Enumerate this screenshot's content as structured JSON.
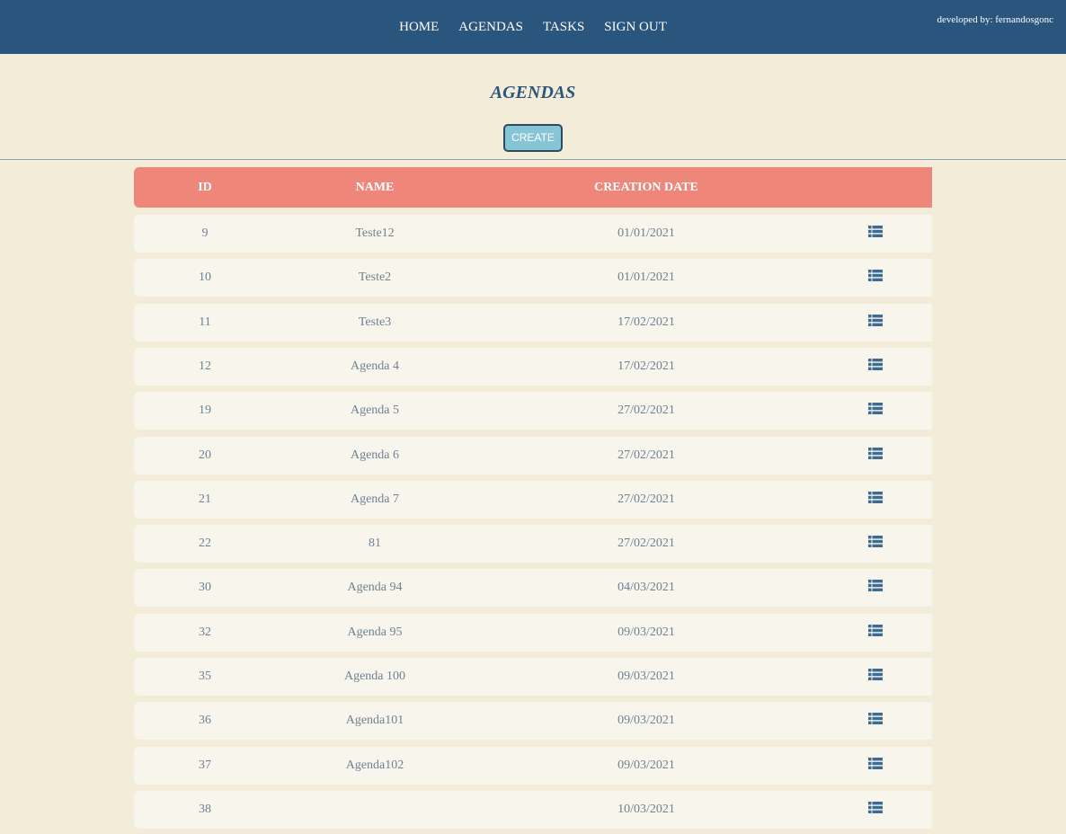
{
  "nav": {
    "items": [
      "HOME",
      "AGENDAS",
      "TASKS",
      "SIGN OUT"
    ],
    "credit": "developed by: fernandosgonc"
  },
  "page": {
    "title": "AGENDAS",
    "create_label": "CREATE"
  },
  "table": {
    "headers": [
      "ID",
      "NAME",
      "CREATION DATE",
      ""
    ],
    "rows": [
      {
        "id": "9",
        "name": "Teste12",
        "date": "01/01/2021"
      },
      {
        "id": "10",
        "name": "Teste2",
        "date": "01/01/2021"
      },
      {
        "id": "11",
        "name": "Teste3",
        "date": "17/02/2021"
      },
      {
        "id": "12",
        "name": "Agenda 4",
        "date": "17/02/2021"
      },
      {
        "id": "19",
        "name": "Agenda 5",
        "date": "27/02/2021"
      },
      {
        "id": "20",
        "name": "Agenda 6",
        "date": "27/02/2021"
      },
      {
        "id": "21",
        "name": "Agenda 7",
        "date": "27/02/2021"
      },
      {
        "id": "22",
        "name": "81",
        "date": "27/02/2021"
      },
      {
        "id": "30",
        "name": "Agenda 94",
        "date": "04/03/2021"
      },
      {
        "id": "32",
        "name": "Agenda 95",
        "date": "09/03/2021"
      },
      {
        "id": "35",
        "name": "Agenda 100",
        "date": "09/03/2021"
      },
      {
        "id": "36",
        "name": "Agenda101",
        "date": "09/03/2021"
      },
      {
        "id": "37",
        "name": "Agenda102",
        "date": "09/03/2021"
      },
      {
        "id": "38",
        "name": "",
        "date": "10/03/2021"
      }
    ],
    "action_icon": "list-icon"
  },
  "colors": {
    "nav_bg": "#2a557d",
    "page_bg": "#f2ecd8",
    "header_bg": "#ee877a",
    "row_bg": "#f8f5ec",
    "row_text": "#6e8294",
    "button_bg": "#86c5d6",
    "icon": "#3d6b92"
  }
}
